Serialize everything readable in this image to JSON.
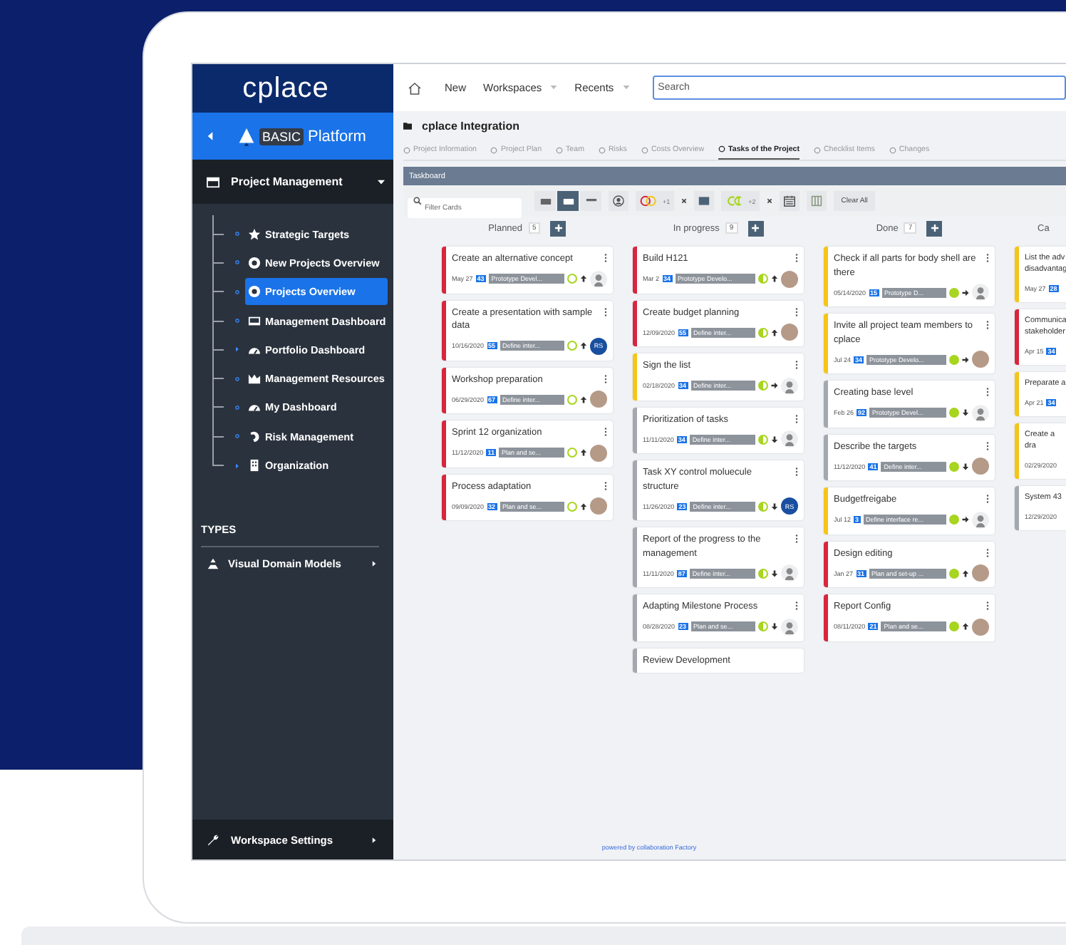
{
  "sidebar": {
    "logo": "cplace",
    "platform": {
      "badge": "BASIC",
      "label": "Platform"
    },
    "section": "Project Management",
    "items": [
      {
        "label": "Strategic Targets",
        "selected": false,
        "has_children": false
      },
      {
        "label": "New Projects Overview",
        "selected": false,
        "has_children": false
      },
      {
        "label": "Projects Overview",
        "selected": true,
        "has_children": false
      },
      {
        "label": "Management Dashboard",
        "selected": false,
        "has_children": false
      },
      {
        "label": "Portfolio Dashboard",
        "selected": false,
        "has_children": true
      },
      {
        "label": "Management Resources",
        "selected": false,
        "has_children": false
      },
      {
        "label": "My Dashboard",
        "selected": false,
        "has_children": false
      },
      {
        "label": "Risk Management",
        "selected": false,
        "has_children": false
      },
      {
        "label": "Organization",
        "selected": false,
        "has_children": true
      }
    ],
    "types_heading": "TYPES",
    "types_items": [
      {
        "label": "Visual Domain Models"
      }
    ],
    "footer": "Workspace Settings"
  },
  "topbar": {
    "nav": [
      {
        "label": "New",
        "dropdown": false
      },
      {
        "label": "Workspaces",
        "dropdown": true
      },
      {
        "label": "Recents",
        "dropdown": true
      }
    ],
    "search_placeholder": "Search"
  },
  "page": {
    "title": "cplace Integration",
    "tabs": [
      {
        "label": "Project Information",
        "selected": false
      },
      {
        "label": "Project Plan",
        "selected": false
      },
      {
        "label": "Team",
        "selected": false
      },
      {
        "label": "Risks",
        "selected": false
      },
      {
        "label": "Costs Overview",
        "selected": false
      },
      {
        "label": "Tasks of the Project",
        "selected": true
      },
      {
        "label": "Checklist Items",
        "selected": false
      },
      {
        "label": "Changes",
        "selected": false
      }
    ]
  },
  "taskboard": {
    "title": "Taskboard",
    "filter_placeholder": "Filter Cards",
    "view_modes": [
      {
        "selected": false
      },
      {
        "selected": true
      },
      {
        "selected": false
      }
    ],
    "chip_counts": [
      "+1",
      "+2"
    ],
    "clear_all": "Clear All",
    "columns": [
      {
        "name": "Planned",
        "count": "5",
        "cards": [
          {
            "title": "Create an alternative concept",
            "date": "May 27",
            "number": "43",
            "tag": "Prototype Devel...",
            "color": "#d7263d",
            "status": {
              "kind": "open"
            },
            "arrow": {
              "kind": "up"
            },
            "avatar": {
              "kind": "placeholder"
            }
          },
          {
            "title": "Create a presentation with sample data",
            "date": "10/16/2020",
            "number": "55",
            "tag": "Define inter...",
            "color": "#d7263d",
            "status": {
              "kind": "open"
            },
            "arrow": {
              "kind": "up"
            },
            "avatar": {
              "kind": "initials",
              "initials": "RS"
            }
          },
          {
            "title": "Workshop preparation",
            "date": "06/29/2020",
            "number": "67",
            "tag": "Define inter...",
            "color": "#d7263d",
            "status": {
              "kind": "open"
            },
            "arrow": {
              "kind": "up"
            },
            "avatar": {
              "kind": "photo"
            }
          },
          {
            "title": "Sprint 12 organization",
            "date": "11/12/2020",
            "number": "11",
            "tag": "Plan and se...",
            "color": "#d7263d",
            "status": {
              "kind": "open"
            },
            "arrow": {
              "kind": "up"
            },
            "avatar": {
              "kind": "photo"
            }
          },
          {
            "title": "Process adaptation",
            "date": "09/09/2020",
            "number": "32",
            "tag": "Plan and se...",
            "color": "#d7263d",
            "status": {
              "kind": "open"
            },
            "arrow": {
              "kind": "up"
            },
            "avatar": {
              "kind": "photo"
            }
          }
        ]
      },
      {
        "name": "In progress",
        "count": "9",
        "cards": [
          {
            "title": "Build H121",
            "date": "Mar 2",
            "number": "34",
            "tag": "Prototype Develo...",
            "color": "#d7263d",
            "status": {
              "kind": "in_progress"
            },
            "arrow": {
              "kind": "up"
            },
            "avatar": {
              "kind": "photo"
            }
          },
          {
            "title": "Create budget planning",
            "date": "12/09/2020",
            "number": "55",
            "tag": "Define inter...",
            "color": "#d7263d",
            "status": {
              "kind": "in_progress"
            },
            "arrow": {
              "kind": "up"
            },
            "avatar": {
              "kind": "photo"
            }
          },
          {
            "title": "Sign the list",
            "date": "02/18/2020",
            "number": "34",
            "tag": "Define inter...",
            "color": "#f5c518",
            "status": {
              "kind": "in_progress"
            },
            "arrow": {
              "kind": "right"
            },
            "avatar": {
              "kind": "placeholder"
            }
          },
          {
            "title": "Prioritization of tasks",
            "date": "11/11/2020",
            "number": "34",
            "tag": "Define inter...",
            "color": "#a3a8b0",
            "status": {
              "kind": "in_progress"
            },
            "arrow": {
              "kind": "down"
            },
            "avatar": {
              "kind": "placeholder"
            }
          },
          {
            "title": "Task XY control moluecule structure",
            "date": "11/26/2020",
            "number": "23",
            "tag": "Define inter...",
            "color": "#a3a8b0",
            "status": {
              "kind": "in_progress"
            },
            "arrow": {
              "kind": "down"
            },
            "avatar": {
              "kind": "initials",
              "initials": "RS"
            }
          },
          {
            "title": "Report of the progress to the management",
            "date": "11/11/2020",
            "number": "87",
            "tag": "Define inter...",
            "color": "#a3a8b0",
            "status": {
              "kind": "in_progress"
            },
            "arrow": {
              "kind": "down"
            },
            "avatar": {
              "kind": "placeholder"
            }
          },
          {
            "title": "Adapting Milestone Process",
            "date": "08/28/2020",
            "number": "23",
            "tag": "Plan and se...",
            "color": "#a3a8b0",
            "status": {
              "kind": "in_progress"
            },
            "arrow": {
              "kind": "down"
            },
            "avatar": {
              "kind": "placeholder"
            }
          },
          {
            "title": "Review Development",
            "color": "#a3a8b0"
          }
        ]
      },
      {
        "name": "Done",
        "count": "7",
        "cards": [
          {
            "title": "Check if all parts for body shell are there",
            "date": "05/14/2020",
            "number": "15",
            "tag": "Prototype D...",
            "color": "#f5c518",
            "status": {
              "kind": "done"
            },
            "arrow": {
              "kind": "right"
            },
            "avatar": {
              "kind": "placeholder"
            }
          },
          {
            "title": "Invite all project team members to cplace",
            "date": "Jul 24",
            "number": "34",
            "tag": "Prototype Develo...",
            "color": "#f5c518",
            "status": {
              "kind": "done"
            },
            "arrow": {
              "kind": "right"
            },
            "avatar": {
              "kind": "photo"
            }
          },
          {
            "title": "Creating base level",
            "date": "Feb 26",
            "number": "92",
            "tag": "Prototype Devel...",
            "color": "#a3a8b0",
            "status": {
              "kind": "done"
            },
            "arrow": {
              "kind": "down"
            },
            "avatar": {
              "kind": "placeholder"
            }
          },
          {
            "title": "Describe the targets",
            "date": "11/12/2020",
            "number": "41",
            "tag": "Define inter...",
            "color": "#a3a8b0",
            "status": {
              "kind": "done"
            },
            "arrow": {
              "kind": "down"
            },
            "avatar": {
              "kind": "photo"
            }
          },
          {
            "title": "Budgetfreigabe",
            "date": "Jul 12",
            "number": "3",
            "tag": "Define interface re...",
            "color": "#f5c518",
            "status": {
              "kind": "done"
            },
            "arrow": {
              "kind": "right"
            },
            "avatar": {
              "kind": "placeholder"
            }
          },
          {
            "title": "Design editing",
            "date": "Jan 27",
            "number": "31",
            "tag": "Plan and set-up ...",
            "color": "#d7263d",
            "status": {
              "kind": "done"
            },
            "arrow": {
              "kind": "up"
            },
            "avatar": {
              "kind": "photo"
            }
          },
          {
            "title": "Report Config",
            "date": "08/11/2020",
            "number": "21",
            "tag": "Plan and se...",
            "color": "#d7263d",
            "status": {
              "kind": "done"
            },
            "arrow": {
              "kind": "up"
            },
            "avatar": {
              "kind": "photo"
            }
          }
        ]
      },
      {
        "name": "Ca",
        "cards": [
          {
            "title": "List the adv disadvantag",
            "date": "May 27",
            "number": "28",
            "color": "#f5c518"
          },
          {
            "title": "Communica stakeholder",
            "date": "Apr 15",
            "number": "34",
            "color": "#d7263d"
          },
          {
            "title": "Preparate a",
            "date": "Apr 21",
            "number": "34",
            "color": "#f5c518"
          },
          {
            "title": "Create a dra",
            "date": "02/29/2020",
            "color": "#f5c518"
          },
          {
            "title": "System 43",
            "date": "12/29/2020",
            "color": "#a3a8b0"
          }
        ]
      }
    ]
  },
  "footer": "powered by collaboration Factory"
}
